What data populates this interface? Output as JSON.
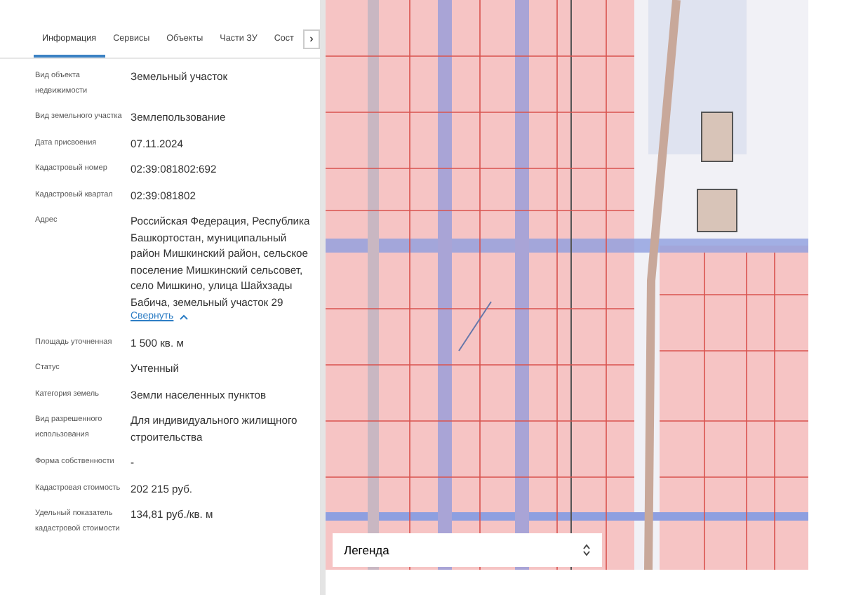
{
  "tabs": [
    {
      "label": "Информация",
      "selected": true
    },
    {
      "label": "Сервисы",
      "selected": false
    },
    {
      "label": "Объекты",
      "selected": false
    },
    {
      "label": "Части ЗУ",
      "selected": false
    },
    {
      "label": "Сост",
      "selected": false
    }
  ],
  "tabs_next": "›",
  "fields": [
    {
      "label": "Вид объекта недвижимости",
      "value": "Земельный участок"
    },
    {
      "label": "Вид земельного участка",
      "value": "Землепользование"
    },
    {
      "label": "Дата присвоения",
      "value": "07.11.2024"
    },
    {
      "label": "Кадастровый номер",
      "value": "02:39:081802:692"
    },
    {
      "label": "Кадастровый квартал",
      "value": "02:39:081802"
    },
    {
      "label": "Адрес",
      "value": "Российская Федерация, Республика Башкортостан, муниципальный район Мишкинский район, сельское поселение Мишкинский сельсовет, село Мишкино, улица Шайхзады Бабича, земельный участок 29",
      "link": "Свернуть"
    },
    {
      "label": "Площадь уточненная",
      "value": "1 500 кв. м"
    },
    {
      "label": "Статус",
      "value": "Учтенный"
    },
    {
      "label": "Категория земель",
      "value": "Земли населенных пунктов"
    },
    {
      "label": "Вид разрешенного использования",
      "value": "Для индивидуального жилищного строительства"
    },
    {
      "label": "Форма собственности",
      "value": "-"
    },
    {
      "label": "Кадастровая стоимость",
      "value": "202 215 руб."
    },
    {
      "label": "Удельный показатель кадастровой стоимости",
      "value": "134,81 руб./кв. м"
    }
  ],
  "legend": {
    "label": "Легенда"
  }
}
